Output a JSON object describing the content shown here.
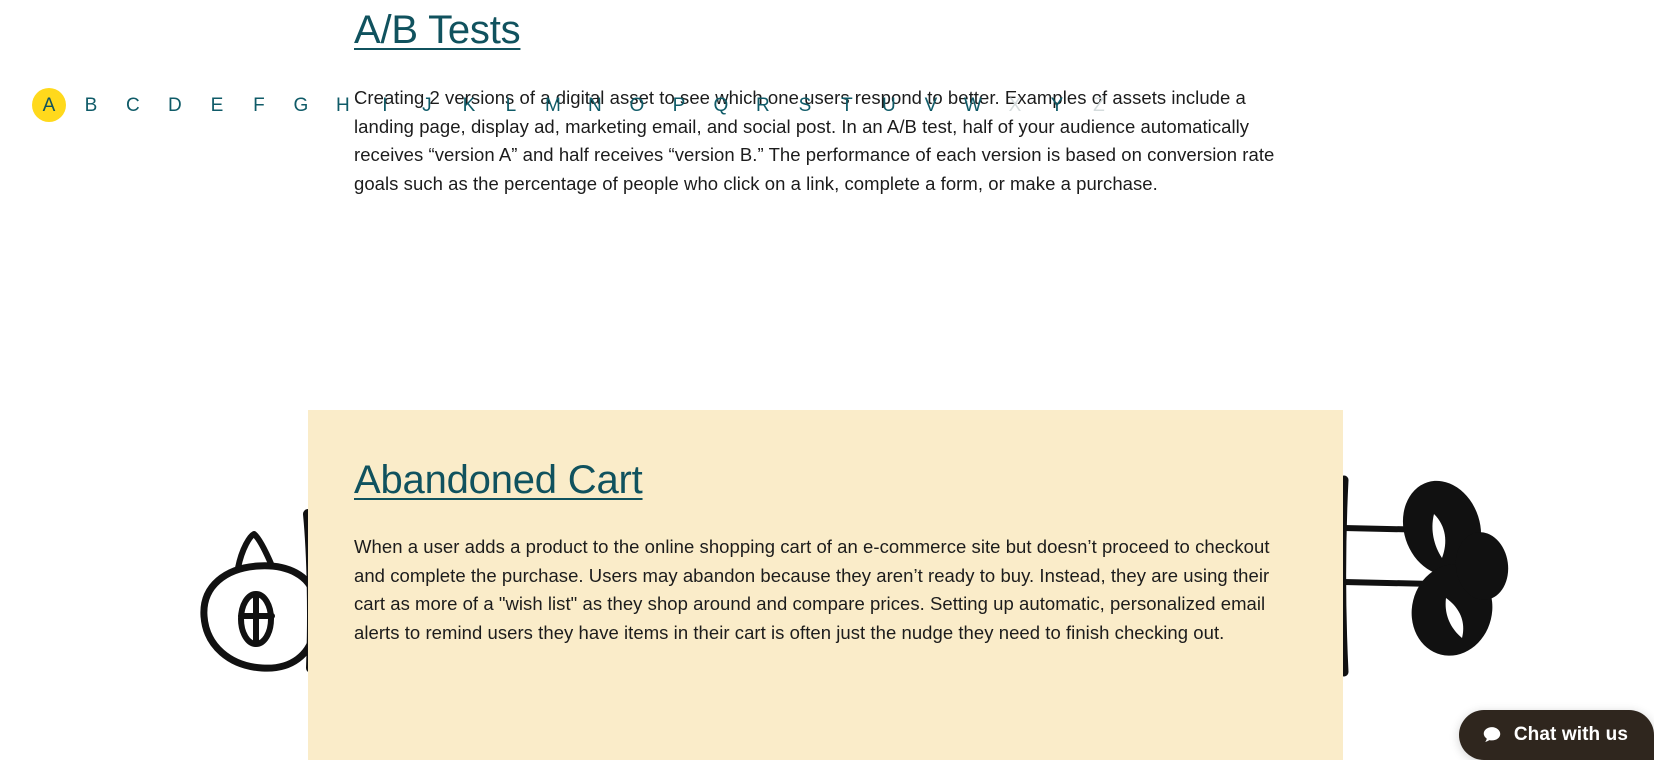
{
  "alphabet_index": {
    "name": "alphabet-index",
    "letters": [
      {
        "label": "A",
        "state": "active"
      },
      {
        "label": "B",
        "state": "enabled"
      },
      {
        "label": "C",
        "state": "enabled"
      },
      {
        "label": "D",
        "state": "enabled"
      },
      {
        "label": "E",
        "state": "enabled"
      },
      {
        "label": "F",
        "state": "enabled"
      },
      {
        "label": "G",
        "state": "enabled"
      },
      {
        "label": "H",
        "state": "enabled"
      },
      {
        "label": "I",
        "state": "enabled"
      },
      {
        "label": "J",
        "state": "enabled"
      },
      {
        "label": "K",
        "state": "enabled"
      },
      {
        "label": "L",
        "state": "enabled"
      },
      {
        "label": "M",
        "state": "enabled"
      },
      {
        "label": "N",
        "state": "enabled"
      },
      {
        "label": "O",
        "state": "enabled"
      },
      {
        "label": "P",
        "state": "enabled"
      },
      {
        "label": "Q",
        "state": "enabled"
      },
      {
        "label": "R",
        "state": "enabled"
      },
      {
        "label": "S",
        "state": "enabled"
      },
      {
        "label": "T",
        "state": "enabled"
      },
      {
        "label": "U",
        "state": "enabled"
      },
      {
        "label": "V",
        "state": "enabled"
      },
      {
        "label": "W",
        "state": "enabled"
      },
      {
        "label": "X",
        "state": "disabled"
      },
      {
        "label": "Y",
        "state": "enabled"
      },
      {
        "label": "Z",
        "state": "disabled"
      }
    ]
  },
  "entries": [
    {
      "id": "ab-tests",
      "heading": "A/B Tests",
      "body": "Creating 2 versions of a digital asset to see which one users respond to better. Examples of assets include a landing page, display ad, marketing email, and social post. In an A/B test, half of your audience automatically receives “version A” and half receives “version B.” The performance of each version is based on conversion rate goals such as the percentage of people who click on a link, complete a form, or make a purchase.",
      "highlighted": false
    },
    {
      "id": "abandoned-cart",
      "heading": "Abandoned Cart",
      "body": "When a user adds a product to the online shopping cart of an e-commerce site but doesn’t proceed to checkout and complete the purchase. Users may abandon because they aren’t ready to buy. Instead, they are using their cart as more of a \"wish list\" as they shop around and compare prices. Setting up automatic, personalized email alerts to remind users they have items in their cart is often just the nudge they need to finish checking out.",
      "highlighted": true
    }
  ],
  "chat_widget": {
    "label": "Chat with us",
    "icon": "chat-bubble-icon"
  },
  "decorations": {
    "left_doodle": "hand-drawn-animal-face-doodle",
    "right_doodle": "hand-drawn-ink-blot-doodle"
  },
  "colors": {
    "heading_teal": "#10525e",
    "index_teal": "#0f5b68",
    "index_disabled": "#d5dcdd",
    "active_highlight_yellow": "#ffd91c",
    "card_cream": "#faecc9",
    "body_text": "#1c1c1c",
    "chat_dark": "#2f261e",
    "page_background": "#ffffff"
  }
}
